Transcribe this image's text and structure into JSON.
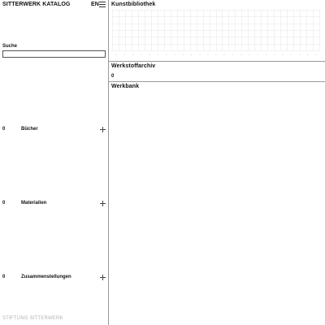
{
  "header": {
    "title": "SITTERWERK KATALOG",
    "lang_label": "EN",
    "menu_icon": "hamburger-menu-icon"
  },
  "search": {
    "label": "Suche",
    "value": "",
    "placeholder": ""
  },
  "categories": [
    {
      "count": "0",
      "label": "Bücher",
      "icon": "plus-icon"
    },
    {
      "count": "0",
      "label": "Materialien",
      "icon": "plus-icon"
    },
    {
      "count": "0",
      "label": "Zusammenstellungen",
      "icon": "plus-icon"
    }
  ],
  "footer": {
    "text": "STIFTUNG SITTERWERK"
  },
  "panels": {
    "kunstbibliothek": {
      "title": "Kunstbibliothek"
    },
    "werkstoffarchiv": {
      "title": "Werkstoffarchiv",
      "count": "0"
    },
    "werkbank": {
      "title": "Werkbank"
    }
  },
  "colors": {
    "divider": "#9a9a9a",
    "grid": "#e6e6e6",
    "text": "#111111",
    "footer": "#b3b3b3"
  }
}
